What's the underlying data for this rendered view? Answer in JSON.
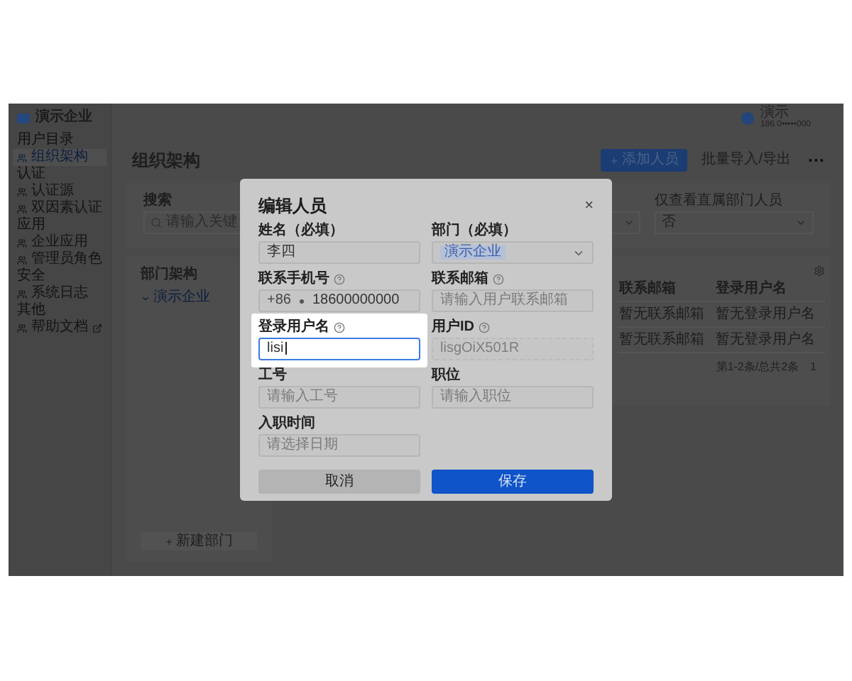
{
  "sidebar": {
    "brand": "演示企业",
    "sections": [
      {
        "title": "用户目录",
        "items": [
          {
            "label": "组织架构",
            "selected": true,
            "external": false
          }
        ]
      },
      {
        "title": "认证",
        "items": [
          {
            "label": "认证源",
            "selected": false,
            "external": false
          },
          {
            "label": "双因素认证",
            "selected": false,
            "external": false
          }
        ]
      },
      {
        "title": "应用",
        "items": [
          {
            "label": "企业应用",
            "selected": false,
            "external": false
          },
          {
            "label": "管理员角色",
            "selected": false,
            "external": false
          }
        ]
      },
      {
        "title": "安全",
        "items": [
          {
            "label": "系统日志",
            "selected": false,
            "external": false
          }
        ]
      },
      {
        "title": "其他",
        "items": [
          {
            "label": "帮助文档",
            "selected": false,
            "external": true
          }
        ]
      }
    ]
  },
  "header": {
    "user_name": "演示",
    "user_phone": "186 0•••••000"
  },
  "page": {
    "title": "组织架构",
    "add_button": "添加人员",
    "import_export": "批量导入/导出",
    "more": "···"
  },
  "filters": {
    "search_label": "搜索",
    "search_placeholder": "请输入关键",
    "direct_label": "仅查看直属部门人员",
    "direct_value": "否"
  },
  "departments": {
    "title": "部门架构",
    "tree": [
      {
        "label": "演示企业",
        "selected": true
      }
    ],
    "new_button": "新建部门"
  },
  "table": {
    "columns": [
      "联系邮箱",
      "登录用户名"
    ],
    "rows": [
      [
        "暂无联系邮箱",
        "暂无登录用户名"
      ],
      [
        "暂无联系邮箱",
        "暂无登录用户名"
      ]
    ],
    "pagination": "第1-2条/总共2条",
    "page": "1"
  },
  "dialog": {
    "title": "编辑人员",
    "close": "×",
    "fields": [
      {
        "label": "姓名（必填）",
        "kind": "text",
        "help": false,
        "focused": false,
        "disabled": false,
        "value": "李四"
      },
      {
        "label": "部门（必填）",
        "kind": "select",
        "help": false,
        "focused": false,
        "disabled": false,
        "tag": "演示企业"
      },
      {
        "label": "联系手机号",
        "kind": "phone",
        "help": true,
        "focused": false,
        "disabled": false,
        "prefix": "+86",
        "value": "18600000000"
      },
      {
        "label": "联系邮箱",
        "kind": "text",
        "help": true,
        "focused": false,
        "disabled": false,
        "placeholder": "请输入用户联系邮箱"
      },
      {
        "label": "登录用户名",
        "kind": "text",
        "help": true,
        "focused": true,
        "disabled": false,
        "value": "lisi"
      },
      {
        "label": "用户ID",
        "kind": "text",
        "help": true,
        "focused": false,
        "disabled": true,
        "value": "lisgOiX501R"
      },
      {
        "label": "工号",
        "kind": "text",
        "help": false,
        "focused": false,
        "disabled": false,
        "placeholder": "请输入工号"
      },
      {
        "label": "职位",
        "kind": "text",
        "help": false,
        "focused": false,
        "disabled": false,
        "placeholder": "请输入职位"
      },
      {
        "label": "入职时间",
        "kind": "date",
        "help": false,
        "focused": false,
        "disabled": false,
        "placeholder": "请选择日期"
      }
    ],
    "buttons": [
      {
        "label": "取消",
        "kind": "secondary"
      },
      {
        "label": "保存",
        "kind": "primary"
      }
    ]
  }
}
